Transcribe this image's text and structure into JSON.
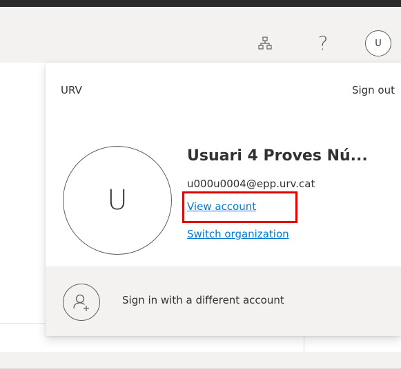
{
  "header": {
    "org_icon": "organization-icon",
    "help_label": "?",
    "avatar_initial": "U"
  },
  "account_panel": {
    "org_name": "URV",
    "sign_out_label": "Sign out",
    "avatar_initial": "U",
    "user_name": "Usuari 4 Proves Nú...",
    "email": "u000u0004@epp.urv.cat",
    "view_account_label": "View account",
    "switch_org_label": "Switch organization",
    "sign_in_different_label": "Sign in with a different account",
    "add_account_icon": "person-add-icon",
    "highlight_color": "#e00000",
    "link_color": "#0078d4"
  }
}
